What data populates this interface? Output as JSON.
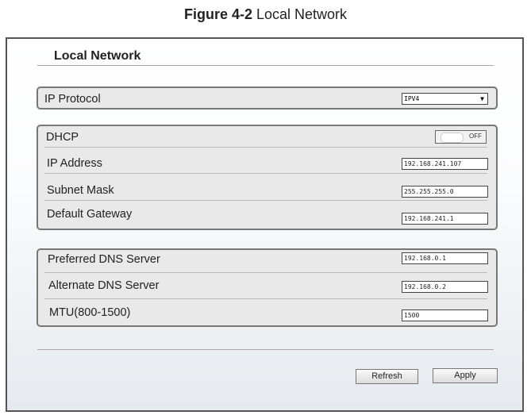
{
  "caption": {
    "figure": "Figure 4-2",
    "title": "Local Network"
  },
  "page_title": "Local Network",
  "ip_protocol": {
    "label": "IP Protocol",
    "value": "IPV4"
  },
  "dhcp": {
    "label": "DHCP",
    "state": "OFF"
  },
  "ip_address": {
    "label": "IP Address",
    "value": "192.168.241.107"
  },
  "subnet_mask": {
    "label": "Subnet Mask",
    "value": "255.255.255.0"
  },
  "default_gateway": {
    "label": "Default Gateway",
    "value": "192.168.241.1"
  },
  "preferred_dns": {
    "label": "Preferred DNS Server",
    "value": "192.168.0.1"
  },
  "alternate_dns": {
    "label": "Alternate DNS Server",
    "value": "192.168.0.2"
  },
  "mtu": {
    "label": "MTU(800-1500)",
    "value": "1500"
  },
  "buttons": {
    "refresh": "Refresh",
    "apply": "Apply"
  }
}
